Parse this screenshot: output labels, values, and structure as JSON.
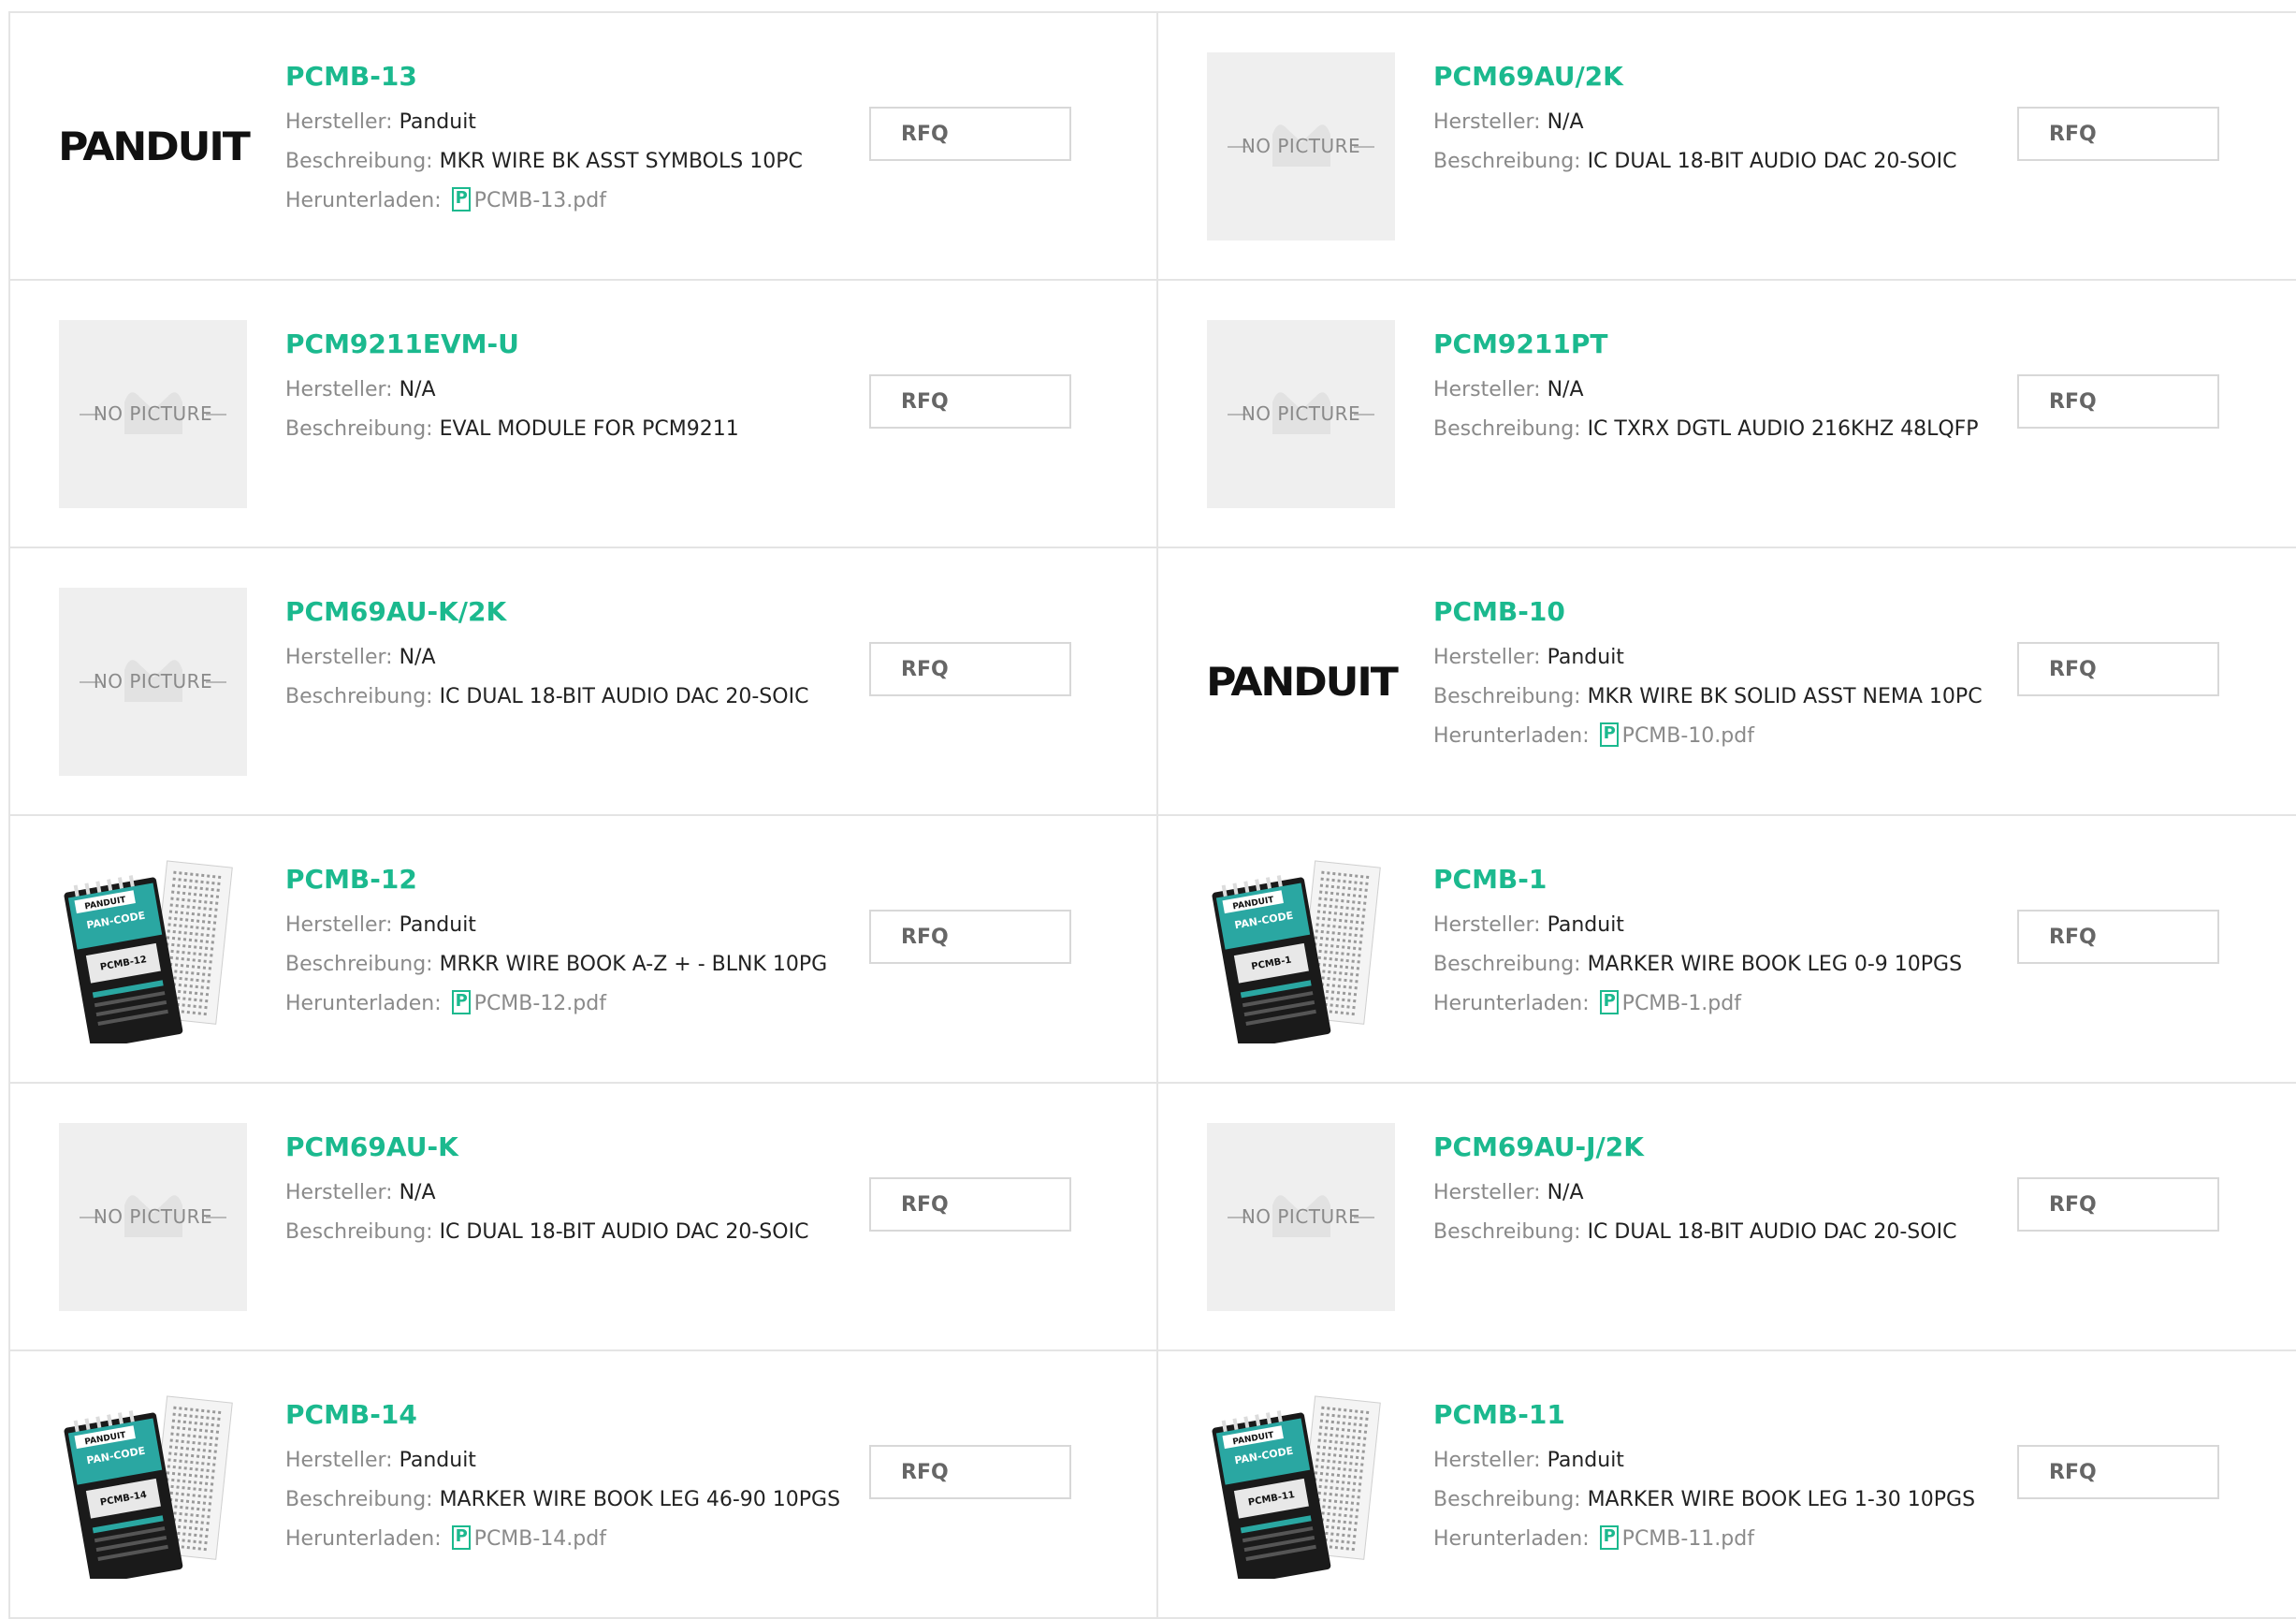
{
  "labels": {
    "manufacturer": "Hersteller:",
    "description": "Beschreibung:",
    "download": "Herunterladen:",
    "rfq": "RFQ",
    "no_picture": "NO PICTURE"
  },
  "colors": {
    "accent": "#1bb98e",
    "label_gray": "#8a8a8a",
    "border": "#e4e4e4"
  },
  "products": [
    {
      "part": "PCMB-13",
      "manufacturer": "Panduit",
      "description": "MKR WIRE BK ASST SYMBOLS 10PC",
      "pdf": "PCMB-13.pdf",
      "image": "panduit-logo"
    },
    {
      "part": "PCM69AU/2K",
      "manufacturer": "N/A",
      "description": "IC DUAL 18-BIT AUDIO DAC 20-SOIC",
      "pdf": null,
      "image": "no-picture"
    },
    {
      "part": "PCM9211EVM-U",
      "manufacturer": "N/A",
      "description": "EVAL MODULE FOR PCM9211",
      "pdf": null,
      "image": "no-picture"
    },
    {
      "part": "PCM9211PT",
      "manufacturer": "N/A",
      "description": "IC TXRX DGTL AUDIO 216KHZ 48LQFP",
      "pdf": null,
      "image": "no-picture"
    },
    {
      "part": "PCM69AU-K/2K",
      "manufacturer": "N/A",
      "description": "IC DUAL 18-BIT AUDIO DAC 20-SOIC",
      "pdf": null,
      "image": "no-picture"
    },
    {
      "part": "PCMB-10",
      "manufacturer": "Panduit",
      "description": "MKR WIRE BK SOLID ASST NEMA 10PC",
      "pdf": "PCMB-10.pdf",
      "image": "panduit-logo"
    },
    {
      "part": "PCMB-12",
      "manufacturer": "Panduit",
      "description": "MRKR WIRE BOOK A-Z + - BLNK 10PG",
      "pdf": "PCMB-12.pdf",
      "image": "marker-book",
      "book_label": "PCMB-12"
    },
    {
      "part": "PCMB-1",
      "manufacturer": "Panduit",
      "description": "MARKER WIRE BOOK LEG 0-9 10PGS",
      "pdf": "PCMB-1.pdf",
      "image": "marker-book",
      "book_label": "PCMB-1"
    },
    {
      "part": "PCM69AU-K",
      "manufacturer": "N/A",
      "description": "IC DUAL 18-BIT AUDIO DAC 20-SOIC",
      "pdf": null,
      "image": "no-picture"
    },
    {
      "part": "PCM69AU-J/2K",
      "manufacturer": "N/A",
      "description": "IC DUAL 18-BIT AUDIO DAC 20-SOIC",
      "pdf": null,
      "image": "no-picture"
    },
    {
      "part": "PCMB-14",
      "manufacturer": "Panduit",
      "description": "MARKER WIRE BOOK LEG 46-90 10PGS",
      "pdf": "PCMB-14.pdf",
      "image": "marker-book",
      "book_label": "PCMB-14"
    },
    {
      "part": "PCMB-11",
      "manufacturer": "Panduit",
      "description": "MARKER WIRE BOOK LEG 1-30 10PGS",
      "pdf": "PCMB-11.pdf",
      "image": "marker-book",
      "book_label": "PCMB-11"
    }
  ],
  "logo_text": "PANDUIT",
  "book_brand": "PANDUIT",
  "book_title": "PAN-CODE"
}
